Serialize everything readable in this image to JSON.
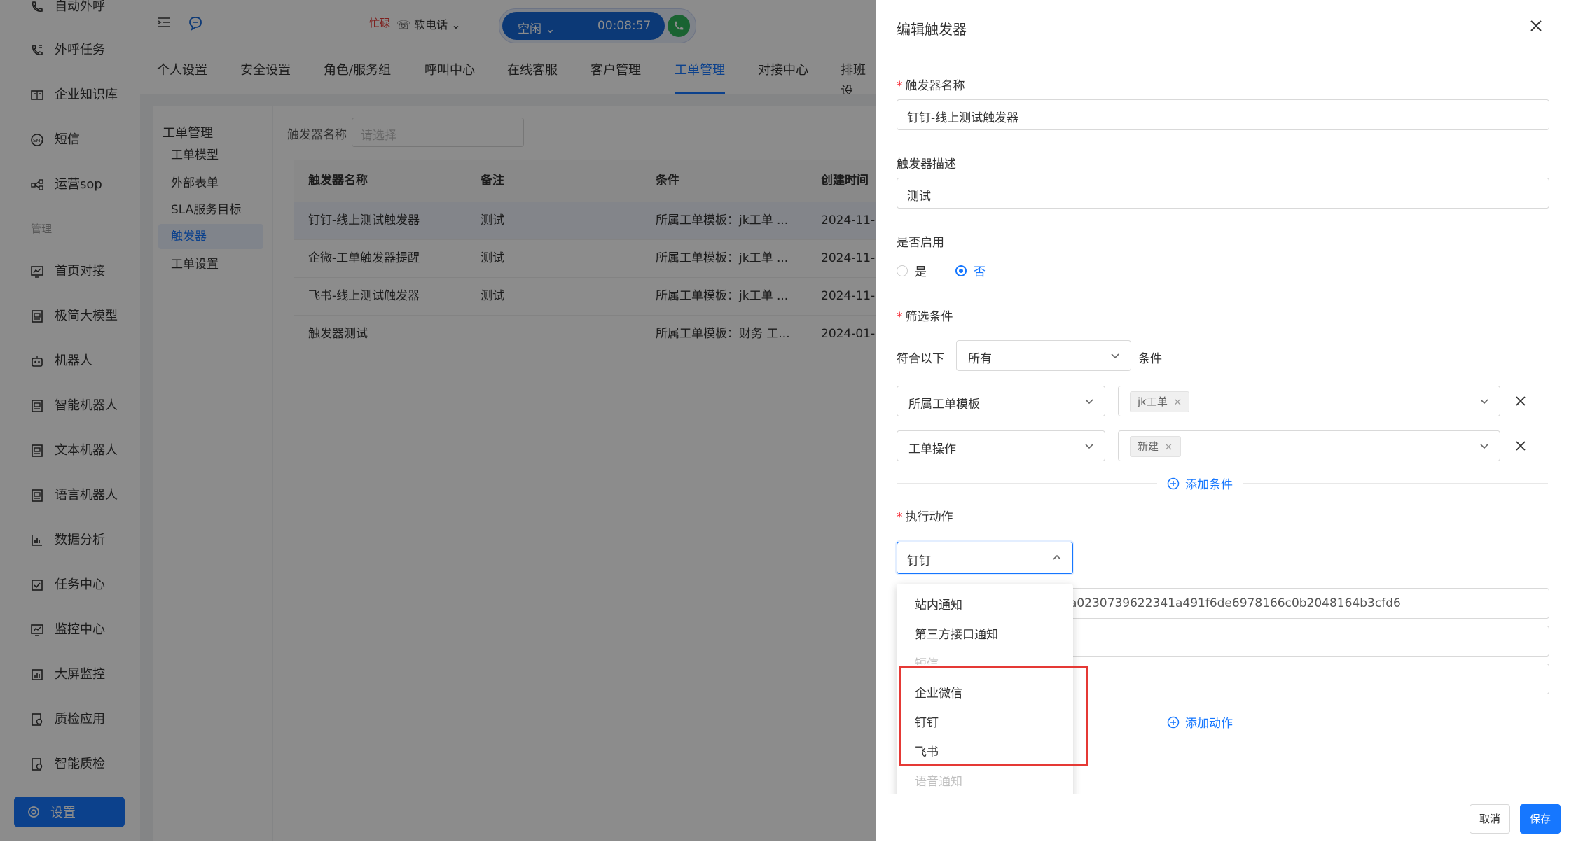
{
  "sidebar": {
    "items": [
      {
        "label": "自动外呼",
        "icon": "phone-call-icon"
      },
      {
        "label": "外呼任务",
        "icon": "phone-task-icon"
      },
      {
        "label": "企业知识库",
        "icon": "book-icon"
      },
      {
        "label": "短信",
        "icon": "sms-icon"
      },
      {
        "label": "运营sop",
        "icon": "flow-icon"
      },
      {
        "label": "首页对接",
        "icon": "chart-screen-icon"
      },
      {
        "label": "极简大模型",
        "icon": "model-icon"
      },
      {
        "label": "机器人",
        "icon": "robot-icon"
      },
      {
        "label": "智能机器人",
        "icon": "smart-robot-icon"
      },
      {
        "label": "文本机器人",
        "icon": "text-robot-icon"
      },
      {
        "label": "语言机器人",
        "icon": "voice-robot-icon"
      },
      {
        "label": "数据分析",
        "icon": "bar-chart-icon"
      },
      {
        "label": "任务中心",
        "icon": "task-check-icon"
      },
      {
        "label": "监控中心",
        "icon": "monitor-icon"
      },
      {
        "label": "大屏监控",
        "icon": "big-screen-icon"
      },
      {
        "label": "质检应用",
        "icon": "inspect-app-icon"
      },
      {
        "label": "智能质检",
        "icon": "smart-inspect-icon"
      }
    ],
    "section_label": "管理",
    "settings_label": "设置"
  },
  "topbar": {
    "status": "忙碌",
    "phone_type": "软电话",
    "call_state": "空闲",
    "call_timer": "00:08:57"
  },
  "tabs": [
    "个人设置",
    "安全设置",
    "角色/服务组",
    "呼叫中心",
    "在线客服",
    "客户管理",
    "工单管理",
    "对接中心",
    "排班设"
  ],
  "active_tab": "工单管理",
  "subnav": {
    "title": "工单管理",
    "items": [
      "工单模型",
      "外部表单",
      "SLA服务目标",
      "触发器",
      "工单设置"
    ],
    "active": "触发器"
  },
  "filter": {
    "label": "触发器名称",
    "placeholder": "请选择"
  },
  "table": {
    "headers": [
      "触发器名称",
      "备注",
      "条件",
      "创建时间"
    ],
    "rows": [
      [
        "钉钉-线上测试触发器",
        "测试",
        "所属工单模板：jk工单 ...",
        "2024-11-"
      ],
      [
        "企微-工单触发器提醒",
        "测试",
        "所属工单模板：jk工单 ...",
        "2024-11-"
      ],
      [
        "飞书-线上测试触发器",
        "测试",
        "所属工单模板：jk工单 ...",
        "2024-11-"
      ],
      [
        "触发器测试",
        "",
        "所属工单模板：财务 工...",
        "2024-01-"
      ]
    ]
  },
  "drawer": {
    "title": "编辑触发器",
    "name_label": "触发器名称",
    "name_value": "钉钉-线上测试触发器",
    "desc_label": "触发器描述",
    "desc_value": "测试",
    "enable_label": "是否启用",
    "enable_yes": "是",
    "enable_no": "否",
    "filter_label": "筛选条件",
    "match_prefix": "符合以下",
    "match_value": "所有",
    "match_suffix": "条件",
    "conditions": [
      {
        "field": "所属工单模板",
        "tag": "jk工单"
      },
      {
        "field": "工单操作",
        "tag": "新建"
      }
    ],
    "add_condition": "添加条件",
    "action_label": "执行动作",
    "action_value": "钉钉",
    "url_value": "oot/send?access_token=8ea0230739622341a491f6de6978166c0b2048164b3cfd6",
    "add_action": "添加动作",
    "dropdown_options": [
      {
        "label": "站内通知",
        "dim": false
      },
      {
        "label": "第三方接口通知",
        "dim": false
      },
      {
        "label": "短信",
        "dim": true
      },
      {
        "label": "企业微信",
        "dim": false
      },
      {
        "label": "钉钉",
        "dim": false
      },
      {
        "label": "飞书",
        "dim": false
      },
      {
        "label": "语音通知",
        "dim": true
      }
    ],
    "cancel": "取消",
    "save": "保存"
  },
  "colors": {
    "primary": "#1677ff",
    "danger": "#e53935",
    "call_green": "#31b45b"
  }
}
